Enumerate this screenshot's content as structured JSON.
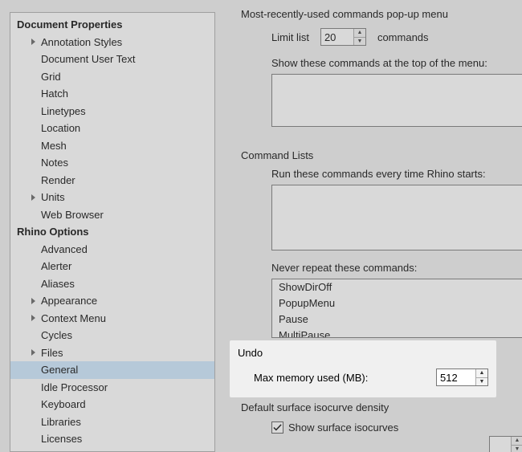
{
  "tree": {
    "root1": "Document Properties",
    "r1_items": [
      {
        "label": "Annotation Styles",
        "expandable": true
      },
      {
        "label": "Document User Text"
      },
      {
        "label": "Grid"
      },
      {
        "label": "Hatch"
      },
      {
        "label": "Linetypes"
      },
      {
        "label": "Location"
      },
      {
        "label": "Mesh"
      },
      {
        "label": "Notes"
      },
      {
        "label": "Render"
      },
      {
        "label": "Units",
        "expandable": true
      },
      {
        "label": "Web Browser"
      }
    ],
    "root2": "Rhino Options",
    "r2_items": [
      {
        "label": "Advanced"
      },
      {
        "label": "Alerter"
      },
      {
        "label": "Aliases"
      },
      {
        "label": "Appearance",
        "expandable": true
      },
      {
        "label": "Context Menu",
        "expandable": true
      },
      {
        "label": "Cycles"
      },
      {
        "label": "Files",
        "expandable": true
      },
      {
        "label": "General",
        "selected": true
      },
      {
        "label": "Idle Processor"
      },
      {
        "label": "Keyboard"
      },
      {
        "label": "Libraries"
      },
      {
        "label": "Licenses"
      }
    ]
  },
  "mru": {
    "title": "Most-recently-used commands pop-up menu",
    "limit_label_pre": "Limit list",
    "limit_value": "20",
    "limit_label_post": "commands",
    "show_top_label": "Show these commands at the top of the menu:"
  },
  "cmd_lists": {
    "title": "Command Lists",
    "startup_label": "Run these commands every time Rhino starts:",
    "never_repeat_label": "Never repeat these commands:",
    "never_repeat_values": [
      "ShowDirOff",
      "PopupMenu",
      "Pause",
      "MultiPause"
    ]
  },
  "undo": {
    "title": "Undo",
    "mem_label": "Max memory used (MB):",
    "mem_value": "512"
  },
  "iso": {
    "title": "Default surface isocurve density",
    "show_label": "Show surface isocurves",
    "show_checked": true
  }
}
